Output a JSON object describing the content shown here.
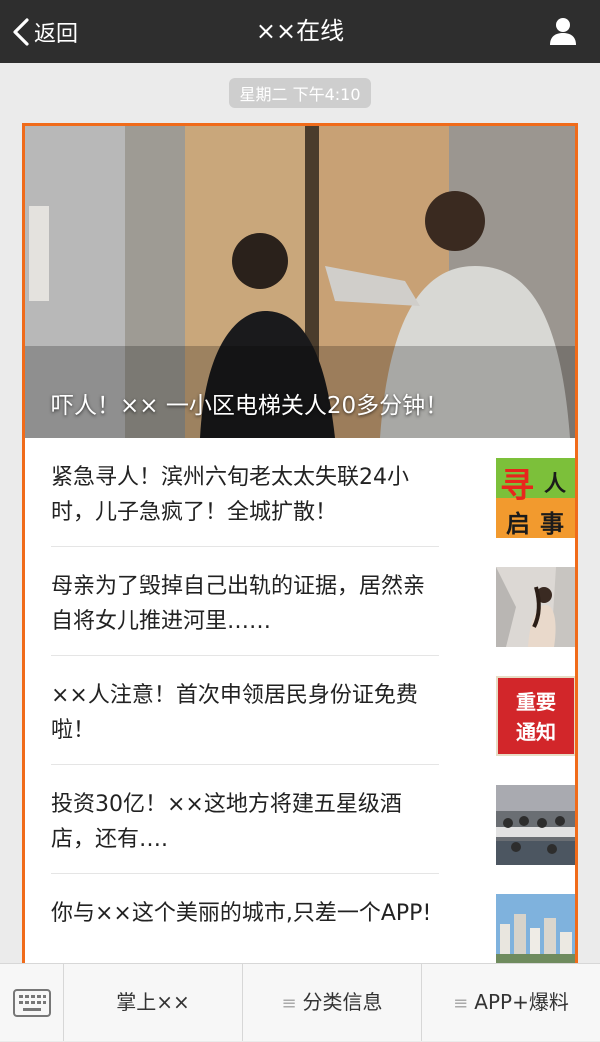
{
  "nav": {
    "back_label": "返回",
    "title": "××在线"
  },
  "timestamp": "星期二 下午4:10",
  "hero": {
    "caption": "吓人！×× 一小区电梯关人20多分钟！"
  },
  "articles": [
    {
      "title": "紧急寻人！滨州六旬老太太失联24小时，儿子急疯了！全城扩散！",
      "thumb": {
        "line1_a": "寻",
        "line1_b": "人",
        "line2_a": "启",
        "line2_b": "事"
      }
    },
    {
      "title": "母亲为了毁掉自己出轨的证据，居然亲自将女儿推进河里……"
    },
    {
      "title": "××人注意！首次申领居民身份证免费啦！",
      "thumb": {
        "line1": "重要",
        "line2": "通知"
      }
    },
    {
      "title": "投资30亿！××这地方将建五星级酒店，还有…."
    },
    {
      "title": "你与××这个美丽的城市,只差一个APP!"
    }
  ],
  "bottom_menu": [
    {
      "label": "掌上××",
      "has_icon": false
    },
    {
      "label": "分类信息",
      "has_icon": true
    },
    {
      "label": "APP+爆料",
      "has_icon": true
    }
  ],
  "colors": {
    "accent": "#f06b1a",
    "topbar": "#2e2e2e"
  }
}
